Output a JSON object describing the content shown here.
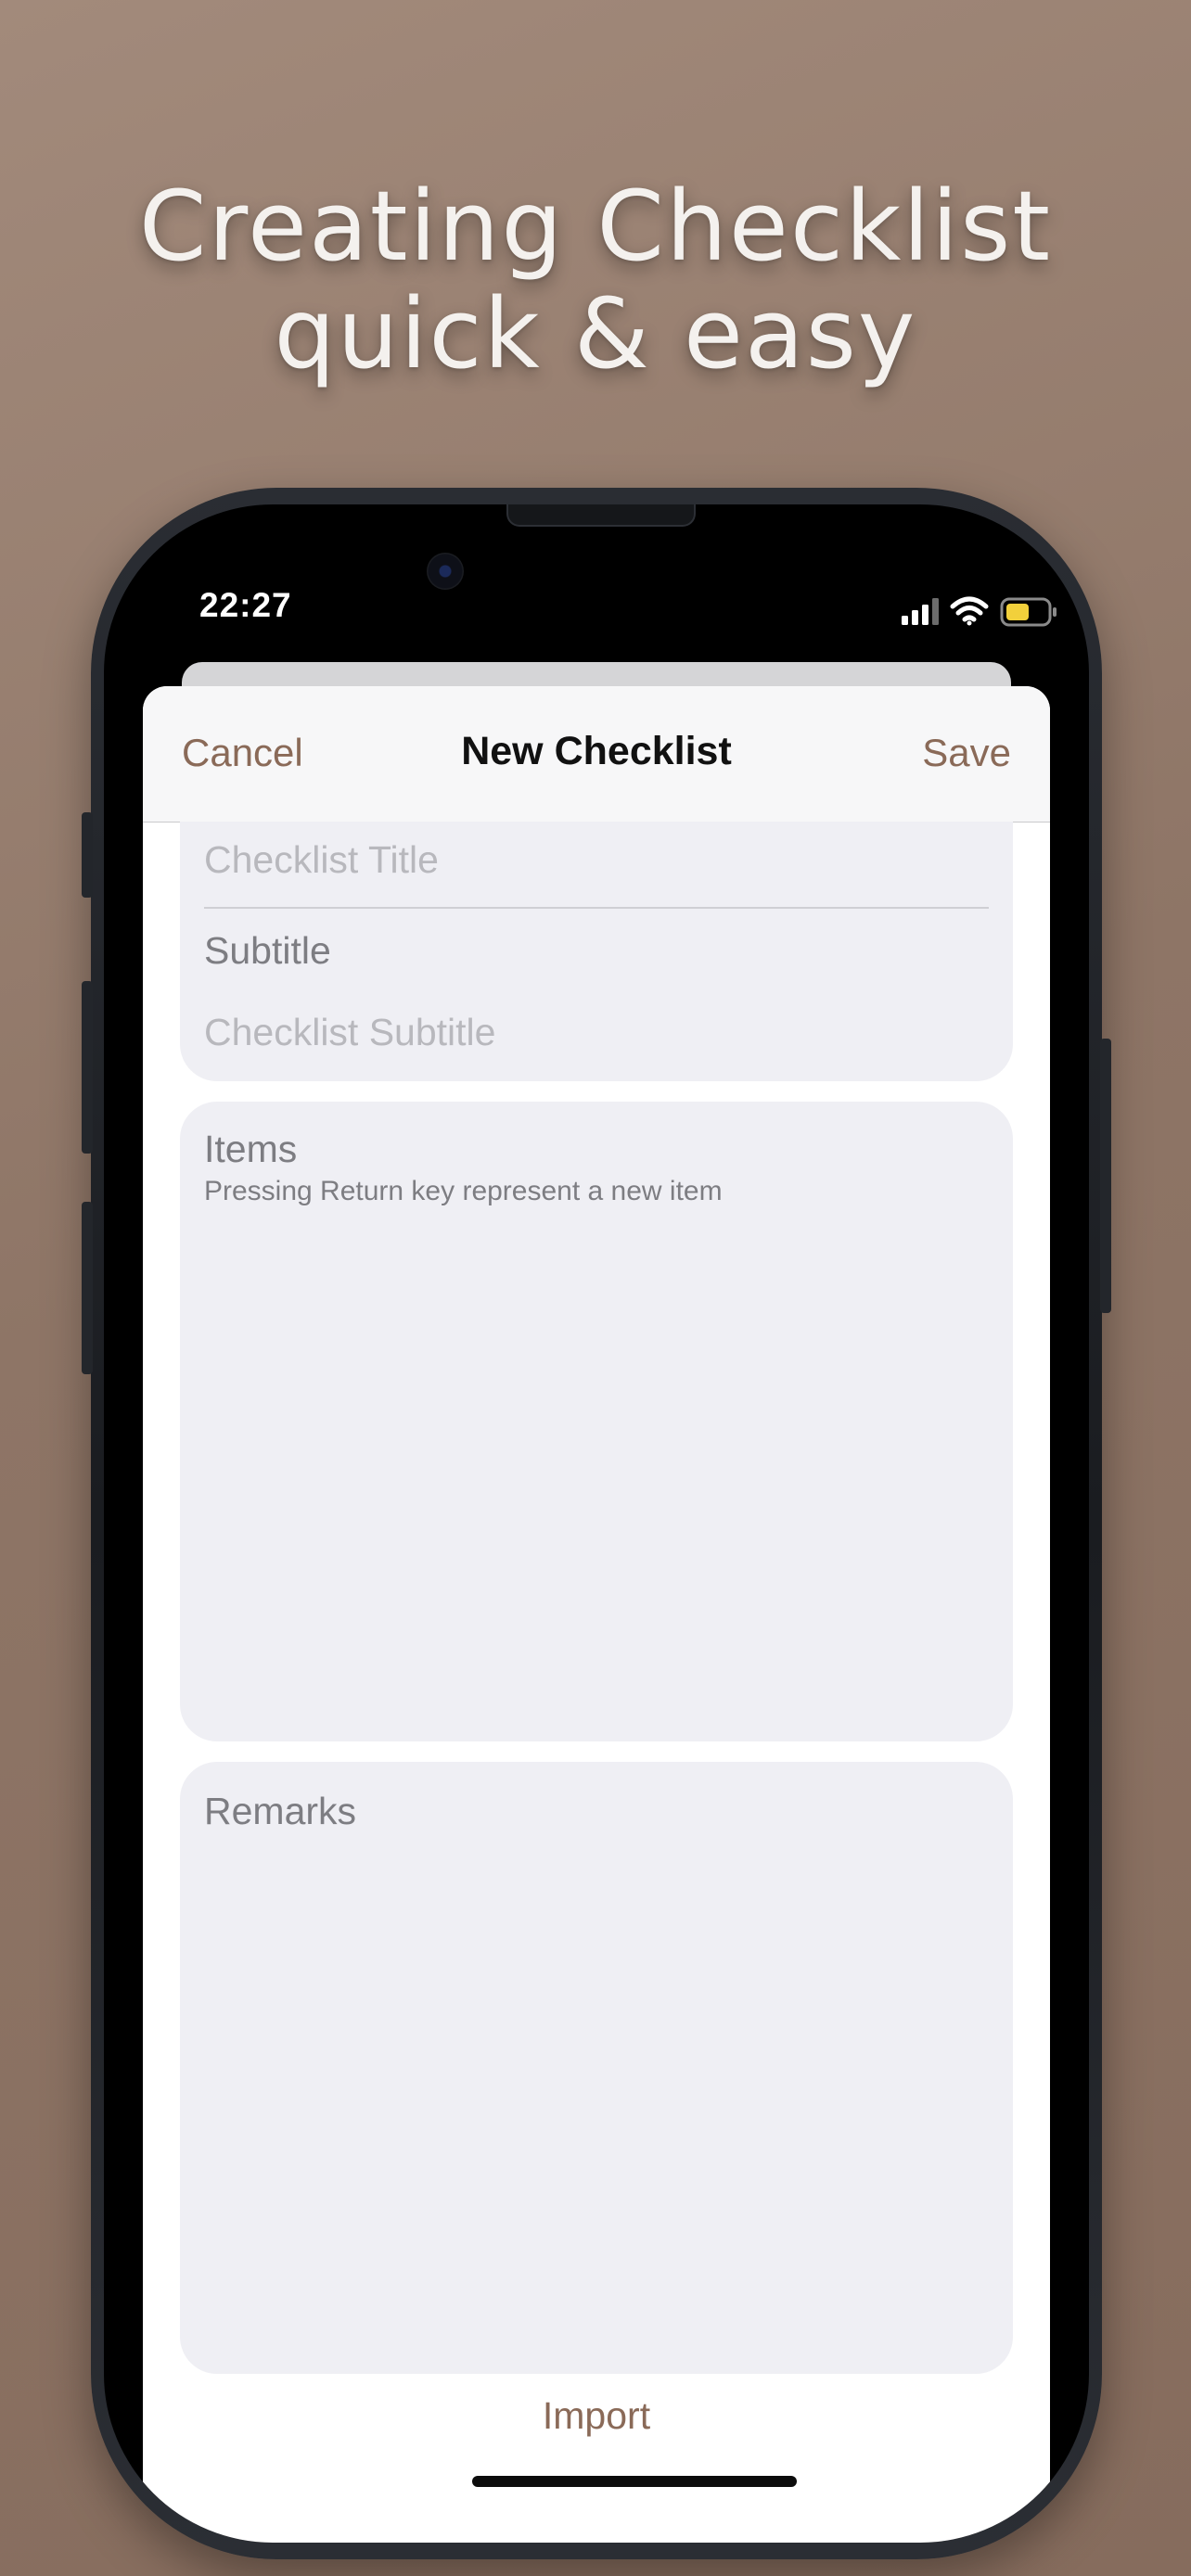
{
  "headline": {
    "line1": "Creating Checklist",
    "line2": "quick & easy"
  },
  "status_bar": {
    "time": "22:27",
    "icons": [
      "cellular-signal-icon",
      "wifi-icon",
      "battery-icon"
    ],
    "battery_color": "#f2d03b"
  },
  "nav": {
    "cancel_label": "Cancel",
    "title": "New Checklist",
    "save_label": "Save"
  },
  "form": {
    "title_placeholder": "Checklist Title",
    "subtitle_label": "Subtitle",
    "subtitle_placeholder": "Checklist Subtitle",
    "items_label": "Items",
    "items_hint": "Pressing Return key represent a new item",
    "remarks_label": "Remarks"
  },
  "footer": {
    "import_label": "Import"
  },
  "colors": {
    "accent": "#8a6a58",
    "background": "#927a6b",
    "field_background": "#efeff4"
  }
}
